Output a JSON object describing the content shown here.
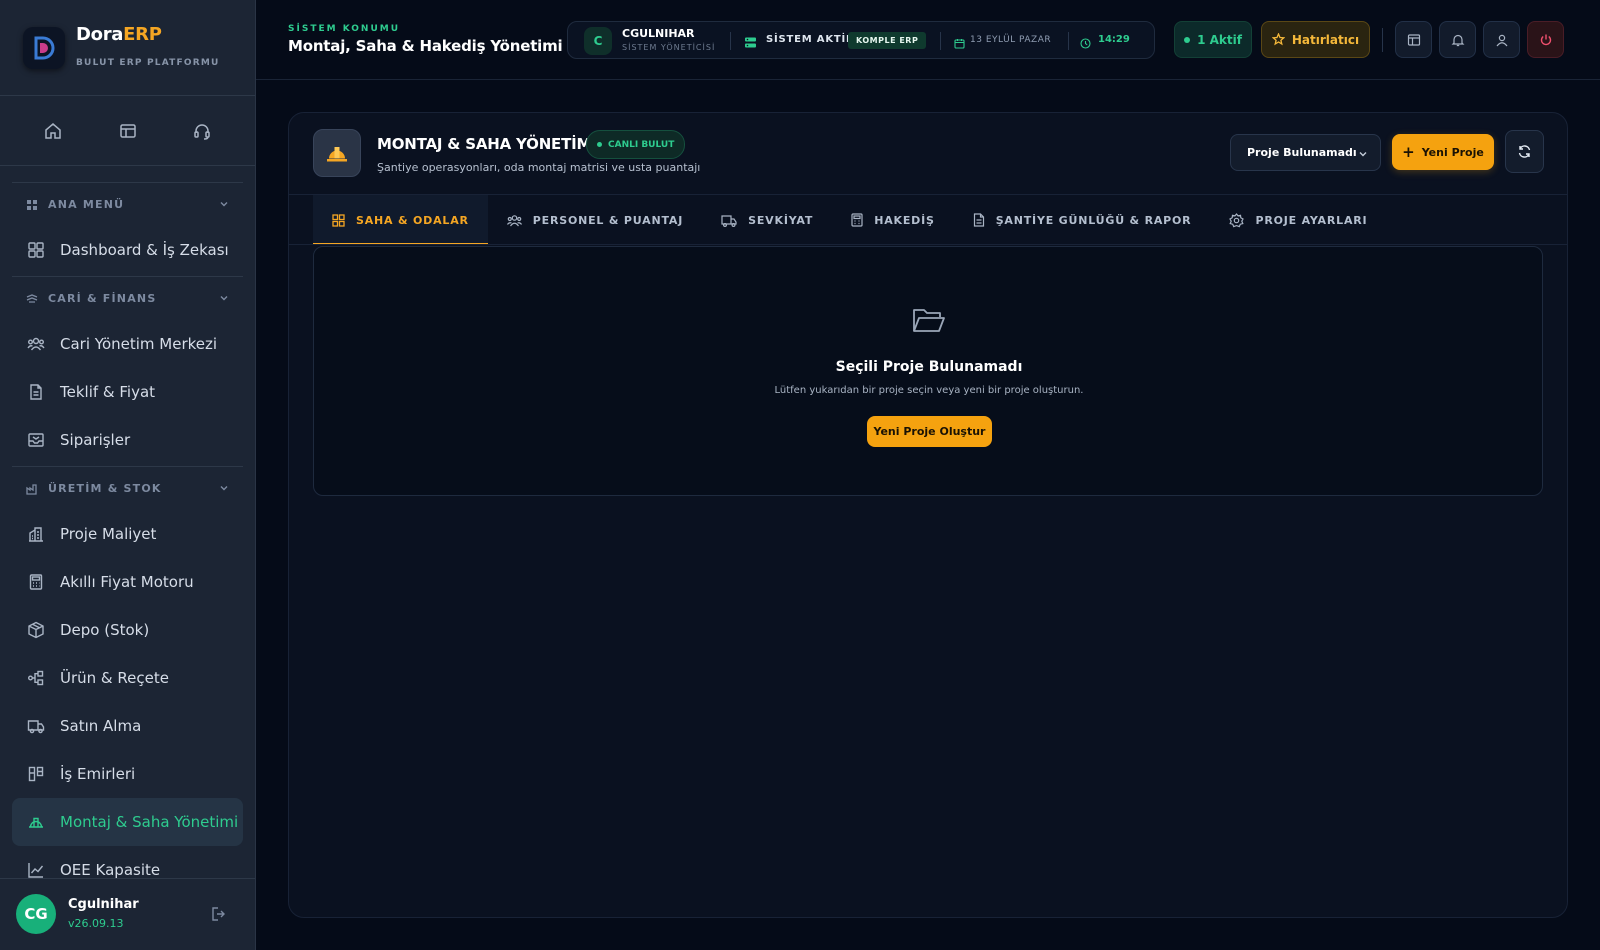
{
  "brand": {
    "name_main": "Dora",
    "name_accent": "ERP",
    "subtitle": "BULUT ERP PLATFORMU"
  },
  "sidebar": {
    "sections": [
      {
        "label": "ANA MENÜ",
        "items": [
          "Dashboard & İş Zekası"
        ]
      },
      {
        "label": "CARİ & FİNANS",
        "items": [
          "Cari Yönetim Merkezi",
          "Teklif & Fiyat",
          "Siparişler"
        ]
      },
      {
        "label": "ÜRETİM & STOK",
        "items": [
          "Proje Maliyet",
          "Akıllı Fiyat Motoru",
          "Depo (Stok)",
          "Ürün & Reçete",
          "Satın Alma",
          "İş Emirleri",
          "Montaj & Saha Yönetimi",
          "OEE Kapasite"
        ]
      }
    ],
    "active_item": "Montaj & Saha Yönetimi",
    "user": {
      "initials": "CG",
      "name": "Cgulnihar",
      "version": "v26.09.13"
    }
  },
  "topbar": {
    "location_label": "SİSTEM KONUMU",
    "location_title": "Montaj, Saha & Hakediş Yönetimi",
    "user_initial": "C",
    "user_name": "CGULNIHAR",
    "user_role": "SİSTEM YÖNETİCİSİ",
    "system_status": "SİSTEM AKTİF",
    "plan_badge": "KOMPLE ERP",
    "date": "13 EYLÜL PAZAR",
    "time": "14:29",
    "active_count": "1 Aktif",
    "reminder": "Hatırlatıcı"
  },
  "card": {
    "title": "MONTAJ & SAHA YÖNETİMİ",
    "live_badge": "CANLI BULUT",
    "subtitle": "Şantiye operasyonları, oda montaj matrisi ve usta puantajı",
    "project_select": "Proje Bulunamadı",
    "new_project": "Yeni Proje",
    "tabs": [
      "SAHA & ODALAR",
      "PERSONEL & PUANTAJ",
      "SEVKİYAT",
      "HAKEDİŞ",
      "ŞANTİYE GÜNLÜĞÜ & RAPOR",
      "PROJE AYARLARI"
    ],
    "active_tab": "SAHA & ODALAR",
    "empty": {
      "title": "Seçili Proje Bulunamadı",
      "subtitle": "Lütfen yukarıdan bir proje seçin veya yeni bir proje oluşturun.",
      "button": "Yeni Proje Oluştur"
    }
  },
  "colors": {
    "accent_green": "#2ecc8f",
    "accent_orange": "#f5a623",
    "background": "#050b18",
    "sidebar": "#1c2534"
  }
}
